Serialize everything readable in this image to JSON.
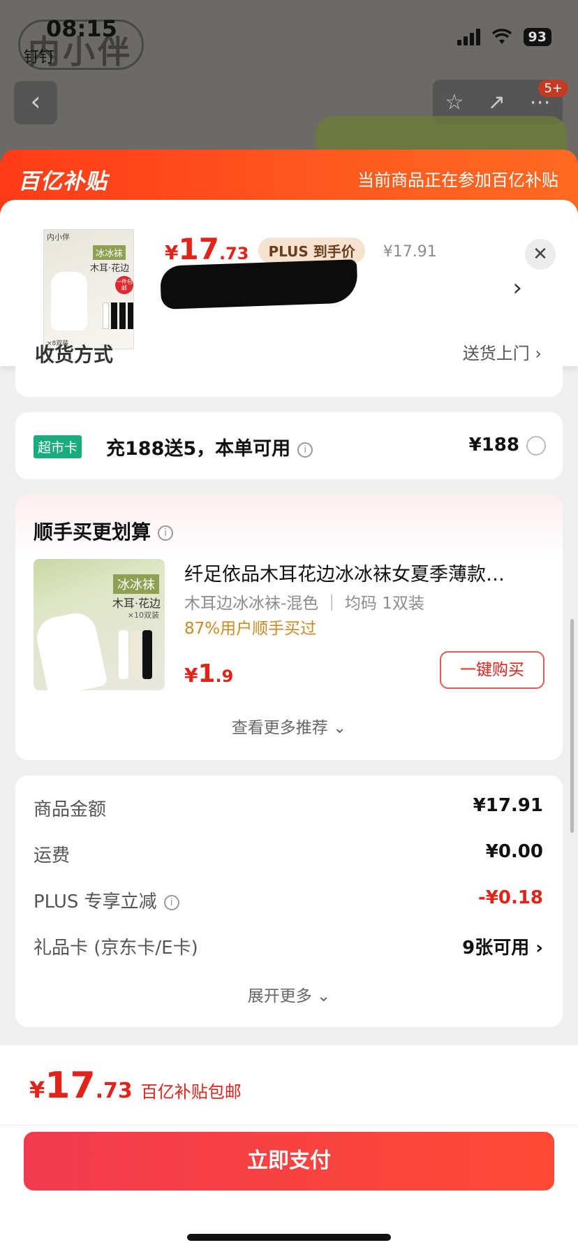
{
  "status_bar": {
    "time": "08:15",
    "sub_label": "钉钉",
    "battery": "93"
  },
  "background": {
    "logo_text": "内小伴",
    "notification_badge": "5+"
  },
  "subsidy_header": {
    "logo": "百亿补贴",
    "info": "当前商品正在参加百亿补贴"
  },
  "product_popup": {
    "thumb": {
      "brand": "内小伴",
      "tag": "冰冰袜",
      "sub": "木耳·花边",
      "pill": "一件包邮",
      "footer": "×8双装"
    },
    "currency": "¥",
    "price_int": "17",
    "price_dec": ".73",
    "plus_tag": "PLUS 到手价",
    "original_price": "¥17.91"
  },
  "partial_card": {
    "left": "收货方式",
    "right": "送货上门 ›"
  },
  "market_card": {
    "tag": "超市卡",
    "text": "充188送5，本单可用",
    "price": "¥188"
  },
  "recommend": {
    "title": "顺手买更划算",
    "img_tag": "冰冰袜",
    "img_sub": "木耳·花边",
    "img_sub2": "×10双装",
    "name": "纤足依品木耳花边冰冰袜女夏季薄款…",
    "spec": "木耳边冰冰袜-混色 ｜ 均码 1双装",
    "bought": "87%用户顺手买过",
    "currency": "¥",
    "price_int": "1",
    "price_dec": ".9",
    "buy_label": "一键购买",
    "more_label": "查看更多推荐 ⌄"
  },
  "summary": {
    "rows": [
      {
        "label": "商品金额",
        "value": "¥17.91"
      },
      {
        "label": "运费",
        "value": "¥0.00"
      },
      {
        "label": "PLUS 专享立减",
        "value": "-¥0.18"
      },
      {
        "label": "礼品卡 (京东卡/E卡)",
        "value": "9张可用 ›"
      }
    ],
    "expand_label": "展开更多 ⌄"
  },
  "bottom": {
    "currency": "¥",
    "total_int": "17",
    "total_dec": ".73",
    "note": "百亿补贴包邮",
    "pay_label": "立即支付"
  },
  "colors": {
    "accent_red": "#e2231a",
    "subsidy_orange": "#ff5a1e",
    "market_green": "#19ad7e",
    "plus_gold": "#f6e3cf"
  }
}
